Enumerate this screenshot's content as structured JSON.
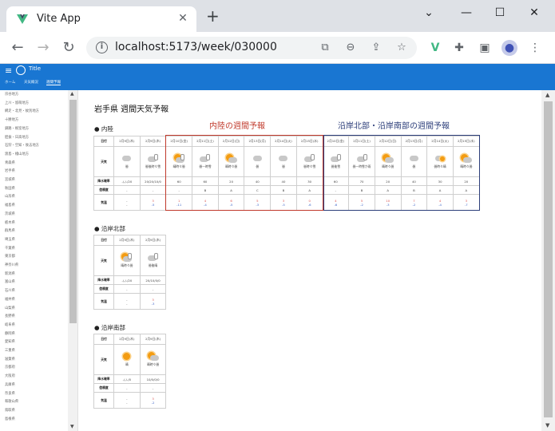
{
  "browser": {
    "tab_title": "Vite App",
    "url": "localhost:5173/week/030000",
    "new_tab": "+",
    "win_min": "⌄",
    "win_minimize": "—",
    "win_max": "☐",
    "win_close": "✕"
  },
  "app": {
    "title": "Title",
    "nav": [
      "ホーム",
      "天気概況",
      "週間予報"
    ]
  },
  "sidebar": {
    "items": [
      "宗谷地方",
      "上川・留萌地方",
      "網走・北見・紋別地方",
      "十勝地方",
      "釧路・根室地方",
      "胆振・日高地方",
      "石狩・空知・後志地方",
      "渡島・檜山地方",
      "青森県",
      "岩手県",
      "宮城県",
      "秋田県",
      "山形県",
      "福島県",
      "茨城県",
      "栃木県",
      "群馬県",
      "埼玉県",
      "千葉県",
      "東京都",
      "神奈川県",
      "新潟県",
      "富山県",
      "石川県",
      "福井県",
      "山梨県",
      "長野県",
      "岐阜県",
      "静岡県",
      "愛知県",
      "三重県",
      "滋賀県",
      "京都府",
      "大阪府",
      "兵庫県",
      "奈良県",
      "和歌山県",
      "鳥取県",
      "島根県"
    ]
  },
  "page": {
    "title": "岩手県 週間天気予報",
    "label_inland": "内陸の週間予報",
    "label_coast": "沿岸北部・沿岸南部の週間予報"
  },
  "row_labels": {
    "date": "日付",
    "weather": "天気",
    "pop": "降水確率",
    "reliability": "信頼度",
    "temp": "気温"
  },
  "sections": [
    {
      "name": "● 内陸",
      "days": [
        {
          "date": "2月9日(木)",
          "icon": "cloud",
          "weather": "曇",
          "pop": "-/-/-/20",
          "rel": "-",
          "tmax": "-",
          "tmin": "-"
        },
        {
          "date": "2月9日(木)",
          "icon": "cloud-snow",
          "weather": "曇後時々雪",
          "pop": "20/20/10/0",
          "rel": "-",
          "tmax": "3",
          "tmin": "-5"
        },
        {
          "date": "2月10日(金)",
          "icon": "sun-cloud-snow",
          "weather": "晴時々曇",
          "pop": "60",
          "rel": "-",
          "tmax": "1",
          "tmin": "-11"
        },
        {
          "date": "2月11日(土)",
          "icon": "cloud-snow",
          "weather": "曇一時雪",
          "pop": "60",
          "rel": "B",
          "tmax": "4",
          "tmin": "-4"
        },
        {
          "date": "2月12日(日)",
          "icon": "sun-cloud",
          "weather": "晴時々曇",
          "pop": "20",
          "rel": "A",
          "tmax": "6",
          "tmin": "-5"
        },
        {
          "date": "2月13日(月)",
          "icon": "cloud",
          "weather": "曇",
          "pop": "40",
          "rel": "C",
          "tmax": "5",
          "tmin": "-3"
        },
        {
          "date": "2月14日(火)",
          "icon": "cloud",
          "weather": "曇",
          "pop": "40",
          "rel": "B",
          "tmax": "3",
          "tmin": "-5"
        },
        {
          "date": "2月15日(水)",
          "icon": "cloud-snow",
          "weather": "曇時々雪",
          "pop": "30",
          "rel": "A",
          "tmax": "0",
          "tmin": "-6"
        },
        {
          "date": "2月10日(金)",
          "icon": "cloud-snow",
          "weather": "曇後雪",
          "pop": "60",
          "rel": "-",
          "tmax": "4",
          "tmin": "-6"
        },
        {
          "date": "2月11日(土)",
          "icon": "cloud-snow",
          "weather": "曇一時雪か雨",
          "pop": "70",
          "rel": "B",
          "tmax": "5",
          "tmin": "-2"
        },
        {
          "date": "2月12日(日)",
          "icon": "sun-cloud",
          "weather": "晴時々曇",
          "pop": "20",
          "rel": "A",
          "tmax": "10",
          "tmin": "-3"
        },
        {
          "date": "2月13日(月)",
          "icon": "cloud",
          "weather": "曇",
          "pop": "40",
          "rel": "B",
          "tmax": "7",
          "tmin": "-2"
        },
        {
          "date": "2月14日(火)",
          "icon": "cloud-sun",
          "weather": "曇時々晴",
          "pop": "30",
          "rel": "A",
          "tmax": "4",
          "tmin": "-4"
        },
        {
          "date": "2月15日(水)",
          "icon": "sun-cloud",
          "weather": "晴時々曇",
          "pop": "20",
          "rel": "A",
          "tmax": "3",
          "tmin": "-7"
        }
      ]
    },
    {
      "name": "● 沿岸北部",
      "days": [
        {
          "date": "2月9日(木)",
          "icon": "sun-cloud-snow",
          "weather": "晴時々曇",
          "pop": "-/-/-/20",
          "rel": "-",
          "tmax": "-",
          "tmin": "-"
        },
        {
          "date": "2月9日(木)",
          "icon": "cloud-snow",
          "weather": "曇後晴",
          "pop": "20/10/0/0",
          "rel": "-",
          "tmax": "3",
          "tmin": "-3"
        }
      ]
    },
    {
      "name": "● 沿岸南部",
      "days": [
        {
          "date": "2月9日(木)",
          "icon": "sun",
          "weather": "晴",
          "pop": "-/-/-/0",
          "rel": "-",
          "tmax": "-",
          "tmin": "-"
        },
        {
          "date": "2月9日(木)",
          "icon": "sun-cloud",
          "weather": "晴時々曇",
          "pop": "10/0/0/0",
          "rel": "-",
          "tmax": "3",
          "tmin": "-2"
        }
      ]
    }
  ],
  "colors": {
    "appbar": "#1976d2",
    "inland_outline": "#c0392b",
    "coast_outline": "#2c3e7a",
    "max_temp": "#d9534f",
    "min_temp": "#3b62c7"
  }
}
